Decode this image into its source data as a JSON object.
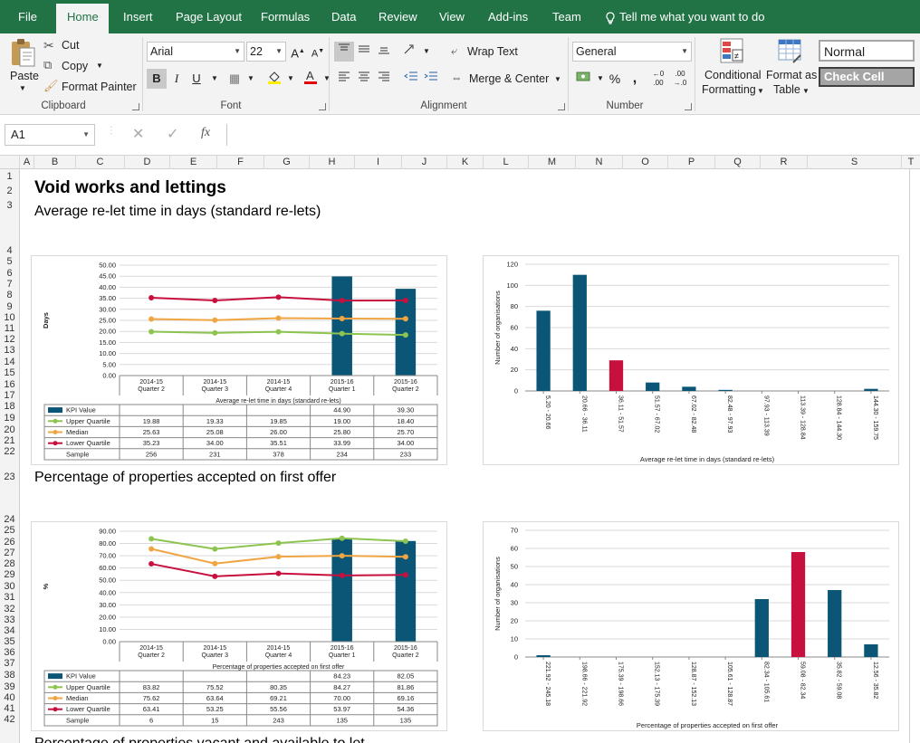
{
  "tabs": [
    "File",
    "Home",
    "Insert",
    "Page Layout",
    "Formulas",
    "Data",
    "Review",
    "View",
    "Add-ins",
    "Team"
  ],
  "tell_me": "Tell me what you want to do",
  "clipboard": {
    "paste": "Paste",
    "cut": "Cut",
    "copy": "Copy",
    "format_painter": "Format Painter",
    "label": "Clipboard"
  },
  "font": {
    "name": "Arial",
    "size": "22",
    "label": "Font",
    "bold": "B",
    "italic": "I",
    "underline": "U"
  },
  "alignment": {
    "wrap_text": "Wrap Text",
    "merge_center": "Merge & Center",
    "label": "Alignment"
  },
  "number": {
    "format": "General",
    "percent": "%",
    "comma": ",",
    "label": "Number"
  },
  "styles": {
    "conditional": "Conditional",
    "formatting": "Formatting",
    "format_as": "Format as",
    "table": "Table",
    "normal": "Normal",
    "check_cell": "Check Cell"
  },
  "formula_bar": {
    "name_box": "A1",
    "fx": "fx",
    "value": ""
  },
  "columns": [
    "A",
    "B",
    "C",
    "D",
    "E",
    "F",
    "G",
    "H",
    "I",
    "J",
    "K",
    "L",
    "M",
    "N",
    "O",
    "P",
    "Q",
    "R",
    "S",
    "T"
  ],
  "rows": [
    "1",
    "2",
    "3",
    "4",
    "5",
    "6",
    "7",
    "8",
    "9",
    "10",
    "11",
    "12",
    "13",
    "14",
    "15",
    "16",
    "17",
    "18",
    "19",
    "20",
    "21",
    "22",
    "23",
    "24",
    "25",
    "26",
    "27",
    "28",
    "29",
    "30",
    "31",
    "32",
    "33",
    "34",
    "35",
    "36",
    "37",
    "38",
    "39",
    "40",
    "41",
    "42"
  ],
  "sheet": {
    "title": "Void works and lettings",
    "section1": "Average re-let time in days (standard re-lets)",
    "section2": "Percentage of properties accepted on first offer",
    "section3": "Percentage of properties vacant and available to let"
  },
  "colors": {
    "kpi": "#0b5676",
    "upper": "#8dc450",
    "median": "#f0a543",
    "lower": "#c8103f",
    "highlight": "#c8103f",
    "excel_green": "#217346"
  },
  "chart_data": [
    {
      "type": "bar",
      "ylabel": "Days",
      "xlabel": "Average re-let time in days (standard re-lets)",
      "ylim": [
        0,
        50
      ],
      "yticks": [
        "0.00",
        "5.00",
        "10.00",
        "15.00",
        "20.00",
        "25.00",
        "30.00",
        "35.00",
        "40.00",
        "45.00",
        "50.00"
      ],
      "categories": [
        "2014-15 Quarter 2",
        "2014-15 Quarter 3",
        "2014-15 Quarter 4",
        "2015-16 Quarter 1",
        "2015-16 Quarter 2"
      ],
      "category_lines": [
        [
          "2014-15",
          "Quarter 2"
        ],
        [
          "2014-15",
          "Quarter 3"
        ],
        [
          "2014-15",
          "Quarter 4"
        ],
        [
          "2015-16",
          "Quarter 1"
        ],
        [
          "2015-16",
          "Quarter 2"
        ]
      ],
      "series": [
        {
          "name": "KPI Value",
          "kind": "bar",
          "values": [
            null,
            null,
            null,
            44.9,
            39.3
          ],
          "labels": [
            "",
            "",
            "",
            "44.90",
            "39.30"
          ]
        },
        {
          "name": "Upper Quartile",
          "kind": "line",
          "values": [
            19.88,
            19.33,
            19.85,
            19.0,
            18.4
          ],
          "labels": [
            "19.88",
            "19.33",
            "19.85",
            "19.00",
            "18.40"
          ]
        },
        {
          "name": "Median",
          "kind": "line",
          "values": [
            25.63,
            25.08,
            26.0,
            25.8,
            25.7
          ],
          "labels": [
            "25.63",
            "25.08",
            "26.00",
            "25.80",
            "25.70"
          ]
        },
        {
          "name": "Lower Quartile",
          "kind": "line",
          "values": [
            35.23,
            34.0,
            35.51,
            33.99,
            34.0
          ],
          "labels": [
            "35.23",
            "34.00",
            "35.51",
            "33.99",
            "34.00"
          ]
        },
        {
          "name": "Sample",
          "kind": "table",
          "values": [
            256,
            231,
            378,
            234,
            233
          ],
          "labels": [
            "256",
            "231",
            "378",
            "234",
            "233"
          ]
        }
      ],
      "legend_labels": [
        "KPI Value",
        "Upper Quartile",
        "Median",
        "Lower Quartile",
        "Sample"
      ]
    },
    {
      "type": "bar",
      "ylabel": "Number of organisations",
      "xlabel": "Average re-let time in days (standard re-lets)",
      "ylim": [
        0,
        120
      ],
      "yticks": [
        "0",
        "20",
        "40",
        "60",
        "80",
        "100",
        "120"
      ],
      "categories": [
        "5.20 - 20.66",
        "20.66 - 36.11",
        "36.11 - 51.57",
        "51.57 - 67.02",
        "67.02 - 82.48",
        "82.48 - 97.93",
        "97.93 - 113.39",
        "113.39 - 128.84",
        "128.84 - 144.30",
        "144.30 - 159.75"
      ],
      "values": [
        76,
        110,
        29,
        8,
        4,
        1,
        0,
        0,
        0,
        2
      ],
      "highlight_index": 2
    },
    {
      "type": "bar",
      "ylabel": "%",
      "xlabel": "Percentage of properties accepted on first offer",
      "ylim": [
        0,
        90
      ],
      "yticks": [
        "0.00",
        "10.00",
        "20.00",
        "30.00",
        "40.00",
        "50.00",
        "60.00",
        "70.00",
        "80.00",
        "90.00"
      ],
      "categories": [
        "2014-15 Quarter 2",
        "2014-15 Quarter 3",
        "2014-15 Quarter 4",
        "2015-16 Quarter 1",
        "2015-16 Quarter 2"
      ],
      "category_lines": [
        [
          "2014-15",
          "Quarter 2"
        ],
        [
          "2014-15",
          "Quarter 3"
        ],
        [
          "2014-15",
          "Quarter 4"
        ],
        [
          "2015-16",
          "Quarter 1"
        ],
        [
          "2015-16",
          "Quarter 2"
        ]
      ],
      "series": [
        {
          "name": "KPI Value",
          "kind": "bar",
          "values": [
            null,
            null,
            null,
            84.23,
            82.05
          ],
          "labels": [
            "",
            "",
            "",
            "84.23",
            "82.05"
          ]
        },
        {
          "name": "Upper Quartile",
          "kind": "line",
          "values": [
            83.82,
            75.52,
            80.35,
            84.27,
            81.86
          ],
          "labels": [
            "83.82",
            "75.52",
            "80.35",
            "84.27",
            "81.86"
          ]
        },
        {
          "name": "Median",
          "kind": "line",
          "values": [
            75.62,
            63.64,
            69.21,
            70.0,
            69.16
          ],
          "labels": [
            "75.62",
            "63.64",
            "69.21",
            "70.00",
            "69.16"
          ]
        },
        {
          "name": "Lower Quartile",
          "kind": "line",
          "values": [
            63.41,
            53.25,
            55.56,
            53.97,
            54.36
          ],
          "labels": [
            "63.41",
            "53.25",
            "55.56",
            "53.97",
            "54.36"
          ]
        },
        {
          "name": "Sample",
          "kind": "table",
          "values": [
            6,
            15,
            243,
            135,
            135
          ],
          "labels": [
            "6",
            "15",
            "243",
            "135",
            "135"
          ]
        }
      ],
      "legend_labels": [
        "KPI Value",
        "Upper Quartile",
        "Median",
        "Lower Quartile",
        "Sample"
      ]
    },
    {
      "type": "bar",
      "ylabel": "Number of organisations",
      "xlabel": "Percentage of properties accepted on first offer",
      "ylim": [
        0,
        70
      ],
      "yticks": [
        "0",
        "10",
        "20",
        "30",
        "40",
        "50",
        "60",
        "70"
      ],
      "categories": [
        "221.92 - 245.18",
        "198.66 - 221.92",
        "175.39 - 198.66",
        "152.13 - 175.39",
        "128.87 - 152.13",
        "105.61 - 128.87",
        "82.34 - 105.61",
        "59.08 - 82.34",
        "35.82 - 59.08",
        "12.56 - 35.82"
      ],
      "values": [
        1,
        0,
        0,
        0,
        0,
        0,
        32,
        58,
        37,
        7
      ],
      "highlight_index": 7
    }
  ]
}
